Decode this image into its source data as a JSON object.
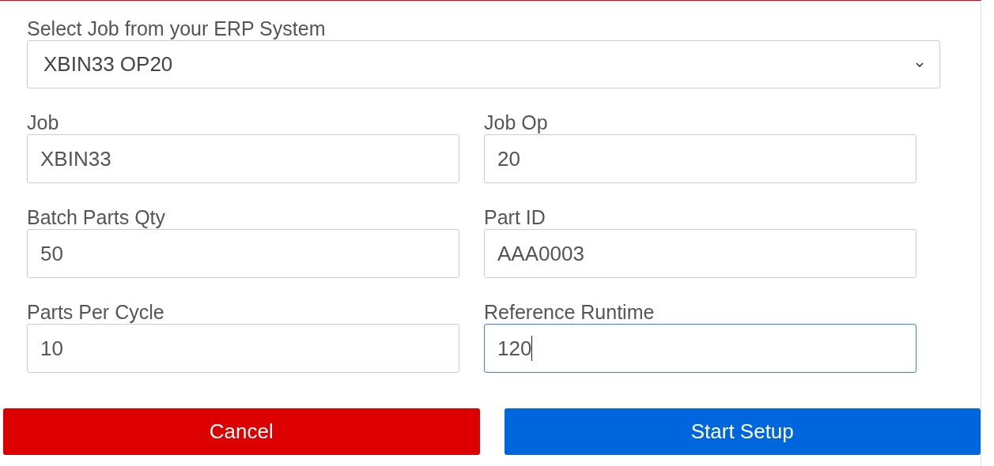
{
  "job_select": {
    "label": "Select Job from your ERP System",
    "value": "XBIN33 OP20"
  },
  "fields": [
    {
      "label": "Job",
      "value": "XBIN33",
      "focused": false
    },
    {
      "label": "Job Op",
      "value": "20",
      "focused": false
    },
    {
      "label": "Batch Parts Qty",
      "value": "50",
      "focused": false
    },
    {
      "label": "Part ID",
      "value": "AAA0003",
      "focused": false
    },
    {
      "label": "Parts Per Cycle",
      "value": "10",
      "focused": false
    },
    {
      "label": "Reference Runtime",
      "value": "120",
      "focused": true
    }
  ],
  "buttons": [
    {
      "label": "Cancel",
      "kind": "cancel"
    },
    {
      "label": "Start Setup",
      "kind": "primary"
    }
  ]
}
